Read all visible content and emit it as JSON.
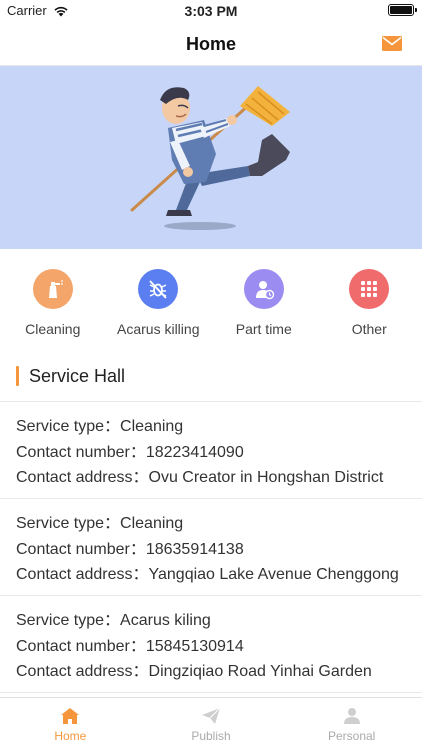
{
  "status_bar": {
    "carrier": "Carrier",
    "time": "3:03 PM"
  },
  "nav": {
    "title": "Home",
    "mail_icon": "mail-icon"
  },
  "banner": {
    "illustration": "cleaning-man-with-broom"
  },
  "categories": [
    {
      "label": "Cleaning",
      "icon": "spray-bottle-icon",
      "color": "#f4a56a"
    },
    {
      "label": "Acarus killing",
      "icon": "no-bug-icon",
      "color": "#5b7ff0"
    },
    {
      "label": "Part time",
      "icon": "worker-clock-icon",
      "color": "#9b8cf2"
    },
    {
      "label": "Other",
      "icon": "grid-dots-icon",
      "color": "#f06b6b"
    }
  ],
  "section": {
    "title": "Service Hall"
  },
  "services": [
    {
      "type": "Service type：Cleaning",
      "phone": "Contact number：18223414090",
      "address": "Contact address：Ovu Creator in Hongshan District"
    },
    {
      "type": "Service type：Cleaning",
      "phone": "Contact number：18635914138",
      "address": "Contact address：Yangqiao Lake Avenue Chenggong"
    },
    {
      "type": "Service type：Acarus kiling",
      "phone": "Contact number：15845130914",
      "address": "Contact address：Dingziqiao Road Yinhai Garden"
    }
  ],
  "tabs": [
    {
      "label": "Home",
      "icon": "home-icon",
      "active": true
    },
    {
      "label": "Publish",
      "icon": "paper-plane-icon",
      "active": false
    },
    {
      "label": "Personal",
      "icon": "person-icon",
      "active": false
    }
  ],
  "colors": {
    "accent": "#f5963c",
    "banner_bg": "#c7d6f8",
    "tab_inactive": "#aaaaaa"
  }
}
